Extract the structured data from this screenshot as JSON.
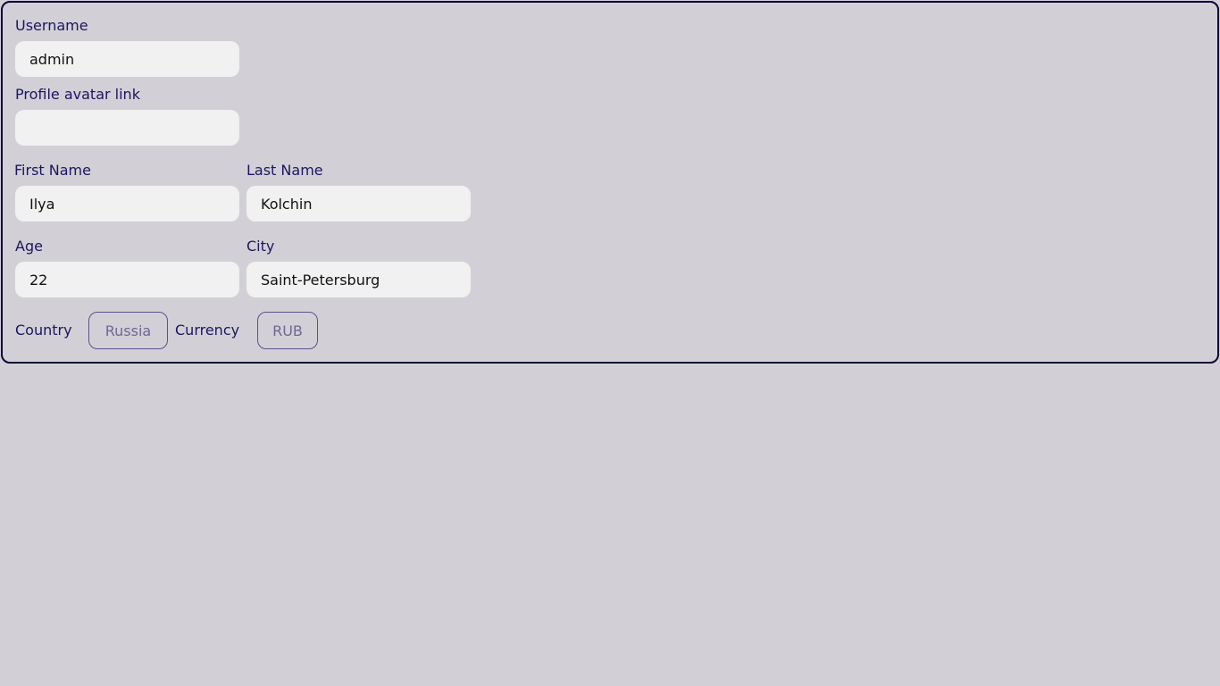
{
  "form": {
    "username": {
      "label": "Username",
      "value": "admin",
      "placeholder": ""
    },
    "avatar": {
      "label": "Profile avatar link",
      "value": "",
      "placeholder": ""
    },
    "first_name": {
      "label": "First Name",
      "value": "Ilya",
      "placeholder": ""
    },
    "last_name": {
      "label": "Last Name",
      "value": "Kolchin",
      "placeholder": ""
    },
    "age": {
      "label": "Age",
      "value": "22",
      "placeholder": ""
    },
    "city": {
      "label": "City",
      "value": "Saint-Petersburg",
      "placeholder": ""
    },
    "country": {
      "label": "Country",
      "selected": "Russia"
    },
    "currency": {
      "label": "Currency",
      "selected": "RUB"
    }
  },
  "colors": {
    "background": "#d2d0d6",
    "border": "#0c0638",
    "label": "#1d1560",
    "input_bg": "#f1f1f1",
    "select_border": "#5a5290",
    "select_text": "#6f6894"
  }
}
